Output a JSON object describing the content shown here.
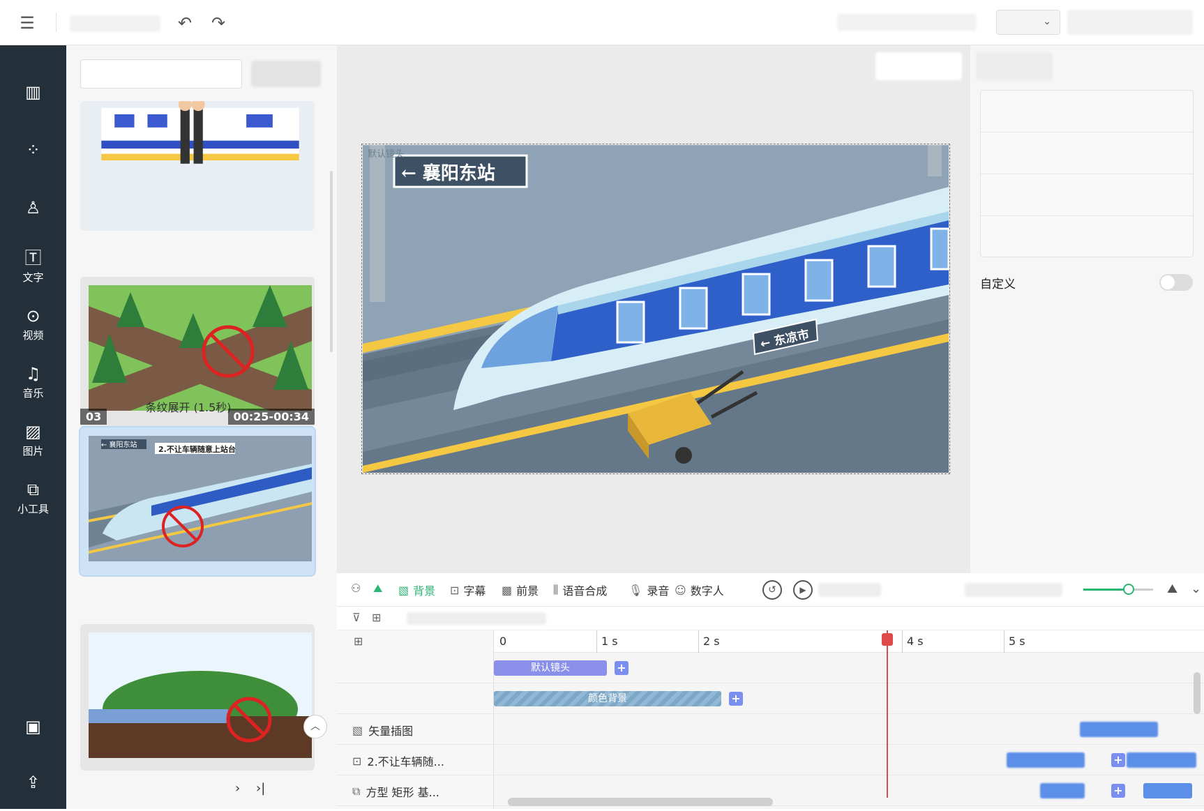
{
  "topbar": {
    "menu_icon": "menu-icon",
    "undo_icon": "undo-icon",
    "redo_icon": "redo-icon",
    "dropdown_icon": "chevron-down-icon"
  },
  "sidebar": {
    "items": [
      {
        "icon": "template-icon",
        "label": ""
      },
      {
        "icon": "elements-icon",
        "label": ""
      },
      {
        "icon": "character-icon",
        "label": ""
      },
      {
        "icon": "text-icon",
        "label": "文字"
      },
      {
        "icon": "video-icon",
        "label": "视频"
      },
      {
        "icon": "music-icon",
        "label": "音乐"
      },
      {
        "icon": "image-icon",
        "label": "图片"
      },
      {
        "icon": "tools-icon",
        "label": "小工具"
      }
    ]
  },
  "scenes": {
    "card2": {
      "index": "03",
      "time": "00:25-00:34"
    },
    "transition_label": "条纹展开 (1.5秒)",
    "card3_caption_sign": "← 襄阳东站",
    "card3_caption": "2.不让车辆随意上站台"
  },
  "canvas": {
    "default_shot_label": "默认镜头",
    "sign_main": "← 襄阳东站",
    "sign_train": "← 东凉市"
  },
  "right": {
    "custom_label": "自定义"
  },
  "timeline": {
    "tools": {
      "background": "背景",
      "subtitle": "字幕",
      "foreground": "前景",
      "tts": "语音合成",
      "record": "录音",
      "avatar": "数字人"
    },
    "ruler": [
      "0",
      "1 s",
      "2 s",
      "4 s",
      "5 s"
    ],
    "tracks": {
      "vector": "矢量插图",
      "text": "2.不让车辆随...",
      "shape": "方型 矩形 基..."
    },
    "clips": {
      "default_shot": "默认镜头",
      "color_bg": "颜色背景"
    },
    "zoom_slider": 0.65,
    "playhead_seconds": 3.8
  },
  "colors": {
    "accent": "#2bb673",
    "sidebar": "#243039",
    "clip": "#8a90ea",
    "playhead": "#e04a4a"
  }
}
